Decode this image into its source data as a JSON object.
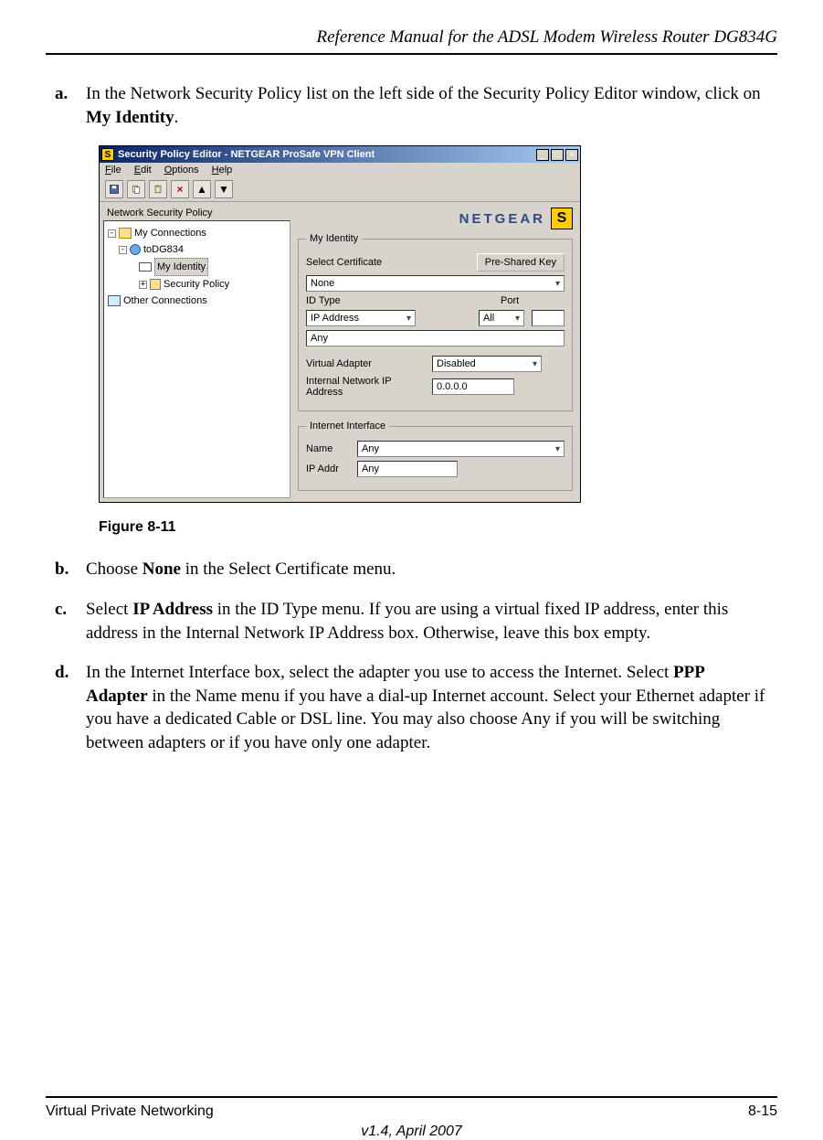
{
  "header": {
    "title": "Reference Manual for the ADSL Modem Wireless Router DG834G"
  },
  "items": {
    "a": {
      "letter": "a.",
      "text": "In the Network Security Policy list on the left side of the Security Policy Editor window, click on ",
      "bold": "My Identity",
      "after": "."
    },
    "b": {
      "letter": "b.",
      "pre": "Choose ",
      "bold": "None",
      "post": " in the Select Certificate menu."
    },
    "c": {
      "letter": "c.",
      "pre": "Select ",
      "bold": "IP Address",
      "post": " in the ID Type menu. If you are using a virtual fixed IP address, enter this address in the Internal Network IP Address box. Otherwise, leave this box empty."
    },
    "d": {
      "letter": "d.",
      "pre": "In the Internet Interface box, select the adapter you use to access the Internet. Select ",
      "bold": "PPP Adapter",
      "post": " in the Name menu if you have a dial-up Internet account. Select your Ethernet adapter if you have a dedicated Cable or DSL line. You may also choose Any if you will be switching between adapters or if you have only one adapter."
    }
  },
  "figure": {
    "caption": "Figure 8-11"
  },
  "window": {
    "title": "Security Policy Editor - NETGEAR ProSafe VPN Client",
    "menus": [
      "File",
      "Edit",
      "Options",
      "Help"
    ],
    "brand": "NETGEAR",
    "left_label": "Network Security Policy",
    "tree": {
      "root": "My Connections",
      "child": "toDG834",
      "my_identity": "My Identity",
      "sec_policy": "Security Policy",
      "other": "Other Connections"
    },
    "identity": {
      "legend": "My Identity",
      "select_cert": "Select Certificate",
      "pre_shared": "Pre-Shared Key",
      "cert_value": "None",
      "id_type_label": "ID Type",
      "port_label": "Port",
      "id_type_value": "IP Address",
      "port_value": "All",
      "any_value": "Any",
      "virtual_adapter": "Virtual Adapter",
      "virtual_value": "Disabled",
      "internal_ip_label": "Internal Network IP Address",
      "internal_ip_value": "0.0.0.0"
    },
    "interface": {
      "legend": "Internet Interface",
      "name_label": "Name",
      "name_value": "Any",
      "ip_label": "IP Addr",
      "ip_value": "Any"
    }
  },
  "footer": {
    "section": "Virtual Private Networking",
    "page": "8-15",
    "version": "v1.4, April 2007"
  }
}
